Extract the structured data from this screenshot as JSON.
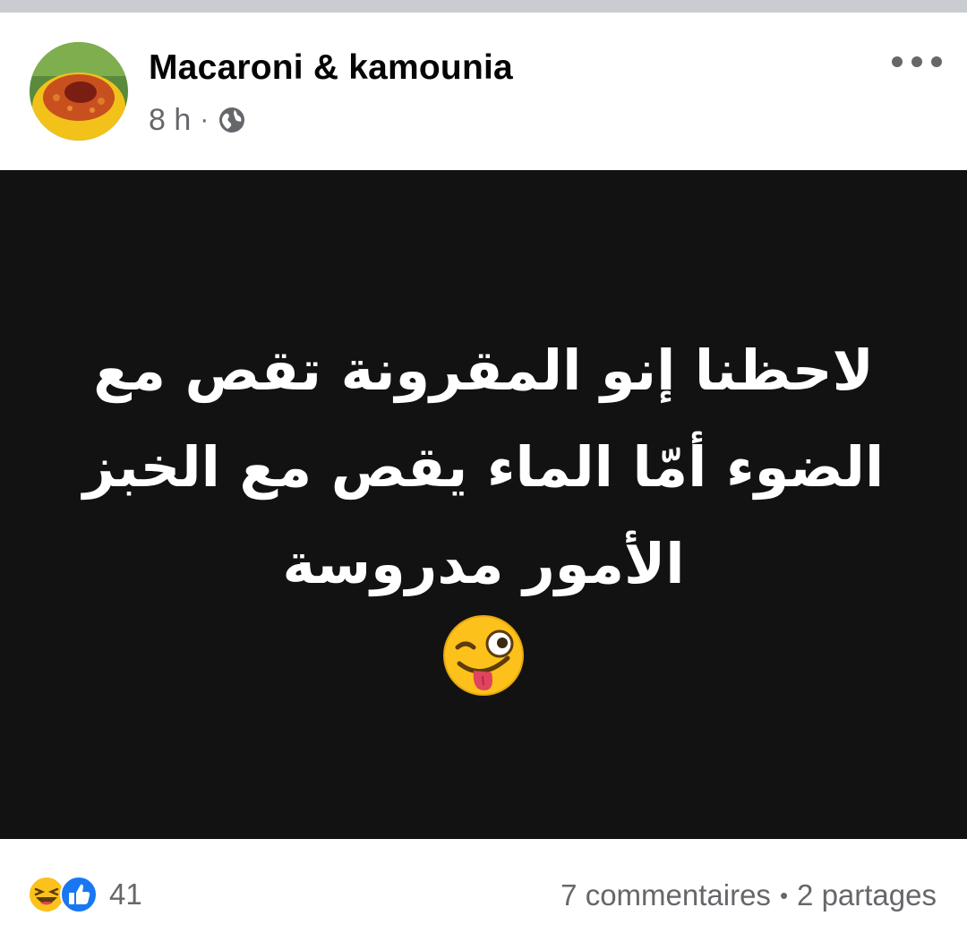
{
  "post": {
    "author": "Macaroni & kamounia",
    "time": "8 h",
    "separator": "·",
    "audience_icon": "globe-icon",
    "more_icon": "more-options-icon"
  },
  "content": {
    "line1": "لاحظنا إنو المقرونة تقص مع",
    "line2": "الضوء أمّا الماء يقص مع الخبز",
    "line3": "الأمور مدروسة",
    "emoji": "winking-face-with-tongue-icon",
    "background_color": "#121212",
    "text_color": "#ffffff"
  },
  "footer": {
    "reaction_icons": [
      "laughing-face-icon",
      "like-thumb-icon"
    ],
    "reaction_count": "41",
    "comments": "7 commentaires",
    "dot": "•",
    "shares": "2 partages"
  },
  "colors": {
    "secondary_text": "#65676b",
    "primary_text": "#050505",
    "like_blue": "#1877f2",
    "top_strip": "#c9ccd1"
  }
}
